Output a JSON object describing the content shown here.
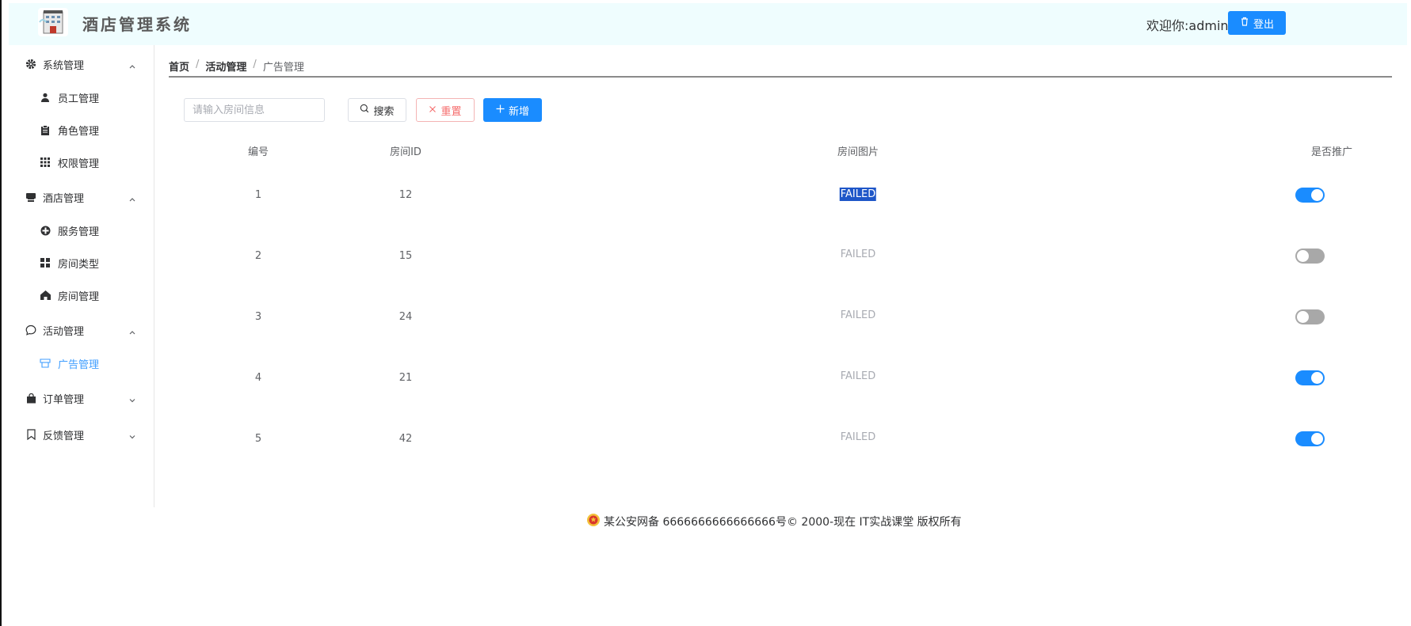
{
  "header": {
    "app_title": "酒店管理系统",
    "welcome": "欢迎你:admin",
    "logout_label": "登出",
    "background": "#effdfe",
    "accent": "#1a8cff"
  },
  "sidebar": {
    "groups": [
      {
        "label": "系统管理",
        "icon": "gear-icon",
        "expanded": true,
        "items": [
          {
            "label": "员工管理",
            "icon": "user-icon"
          },
          {
            "label": "角色管理",
            "icon": "clipboard-icon"
          },
          {
            "label": "权限管理",
            "icon": "grid-icon"
          }
        ]
      },
      {
        "label": "酒店管理",
        "icon": "shop-icon",
        "expanded": true,
        "items": [
          {
            "label": "服务管理",
            "icon": "service-icon"
          },
          {
            "label": "房间类型",
            "icon": "tiles-icon"
          },
          {
            "label": "房间管理",
            "icon": "house-icon"
          }
        ]
      },
      {
        "label": "活动管理",
        "icon": "chat-icon",
        "expanded": true,
        "items": [
          {
            "label": "广告管理",
            "icon": "ad-icon",
            "active": true
          }
        ]
      },
      {
        "label": "订单管理",
        "icon": "bag-icon",
        "expanded": false,
        "items": []
      },
      {
        "label": "反馈管理",
        "icon": "bookmark-icon",
        "expanded": false,
        "items": []
      }
    ],
    "active_color": "#409eff"
  },
  "breadcrumb": [
    "首页",
    "活动管理",
    "广告管理"
  ],
  "toolbar": {
    "search_placeholder": "请输入房间信息",
    "search_label": "搜索",
    "reset_label": "重置",
    "add_label": "新增"
  },
  "table": {
    "headers": [
      "编号",
      "房间ID",
      "房间图片",
      "是否推广"
    ],
    "rows": [
      {
        "id": "1",
        "room_id": "12",
        "image": "FAILED",
        "promoted": true
      },
      {
        "id": "2",
        "room_id": "15",
        "image": "FAILED",
        "promoted": false
      },
      {
        "id": "3",
        "room_id": "24",
        "image": "FAILED",
        "promoted": false
      },
      {
        "id": "4",
        "room_id": "21",
        "image": "FAILED",
        "promoted": true
      },
      {
        "id": "5",
        "room_id": "42",
        "image": "FAILED",
        "promoted": true
      }
    ]
  },
  "footer": {
    "text": "某公安网备 6666666666666666号© 2000-现在 IT实战课堂 版权所有"
  }
}
